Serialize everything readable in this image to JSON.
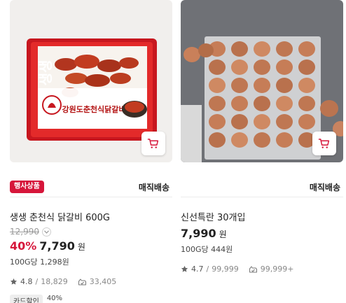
{
  "products": [
    {
      "badge": "행사상품",
      "delivery": "매직배송",
      "name": "생생 춘천식 닭갈비 600G",
      "original_price": "12,990",
      "discount": "40%",
      "price": "7,790",
      "currency": "원",
      "unit_price": "100G당 1,298원",
      "rating": "4.8",
      "rating_sep": "/",
      "review_count": "18,829",
      "wish_count": "33,405",
      "card_discount_label": "카드할인",
      "card_discount_value": "40%",
      "package_brand": "생생",
      "package_title": "강원도춘천식닭갈비"
    },
    {
      "delivery": "매직배송",
      "name": "신선특란 30개입",
      "price": "7,990",
      "currency": "원",
      "unit_price": "100G당 444원",
      "rating": "4.7",
      "rating_sep": "/",
      "review_count": "99,999",
      "wish_count": "99,999+"
    }
  ],
  "colors": {
    "accent": "#d6163a",
    "muted": "#9a9a9a",
    "text": "#222222"
  },
  "icons": [
    "cart-icon",
    "star-icon",
    "wish-icon",
    "chevron-down-icon"
  ]
}
